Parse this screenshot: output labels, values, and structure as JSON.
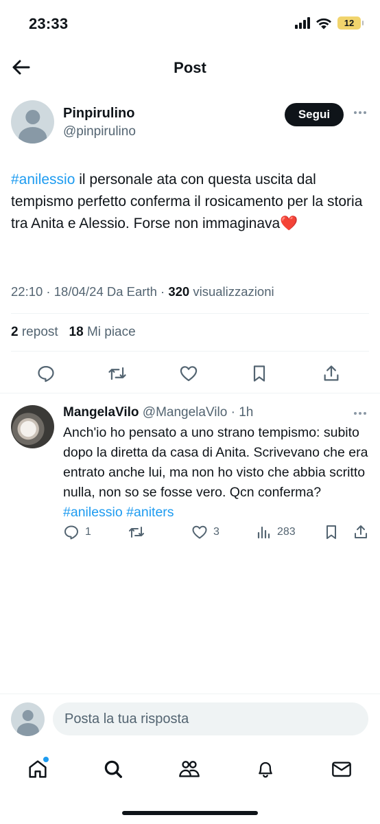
{
  "status_bar": {
    "time": "23:33",
    "battery": "12"
  },
  "header": {
    "title": "Post"
  },
  "post": {
    "author_name": "Pinpirulino",
    "author_handle": "@pinpirulino",
    "follow_label": "Segui",
    "text_hashtag": "#anilessio",
    "text_body": " il personale ata con questa uscita dal tempismo perfetto conferma il rosicamento per la storia tra Anita e Alessio. Forse non immaginava",
    "text_emoji": "❤️",
    "meta_time": "22:10 · 18/04/24 Da Earth · ",
    "meta_views_count": "320",
    "meta_views_label": " visualizzazioni",
    "reposts_count": "2",
    "reposts_label": "repost",
    "likes_count": "18",
    "likes_label": "Mi piace"
  },
  "reply": {
    "author_name": "MangelaVilo",
    "author_handle": "@MangelaVilo",
    "time": "1h",
    "text": "Anch'io ho pensato a uno strano tempismo: subito dopo la diretta da casa di Anita. Scrivevano che era entrato anche lui, ma non ho visto che abbia scritto nulla, non so se fosse vero. Qcn conferma? ",
    "hashtag_1": "#anilessio",
    "hashtag_2": "#aniters",
    "replies_count": "1",
    "likes_count": "3",
    "views_count": "283"
  },
  "compose": {
    "placeholder": "Posta la tua risposta"
  },
  "icons": {
    "back": "arrow-left-icon",
    "reply": "speech-bubble-icon",
    "repost": "repost-icon",
    "like": "heart-icon",
    "bookmark": "bookmark-icon",
    "share": "share-icon",
    "views": "bar-chart-icon",
    "home": "home-icon",
    "search": "search-icon",
    "communities": "people-icon",
    "notifications": "bell-icon",
    "messages": "envelope-icon"
  },
  "colors": {
    "accent": "#1d9bf0",
    "text": "#0f1419",
    "muted": "#536471",
    "heart": "#e0245e"
  }
}
